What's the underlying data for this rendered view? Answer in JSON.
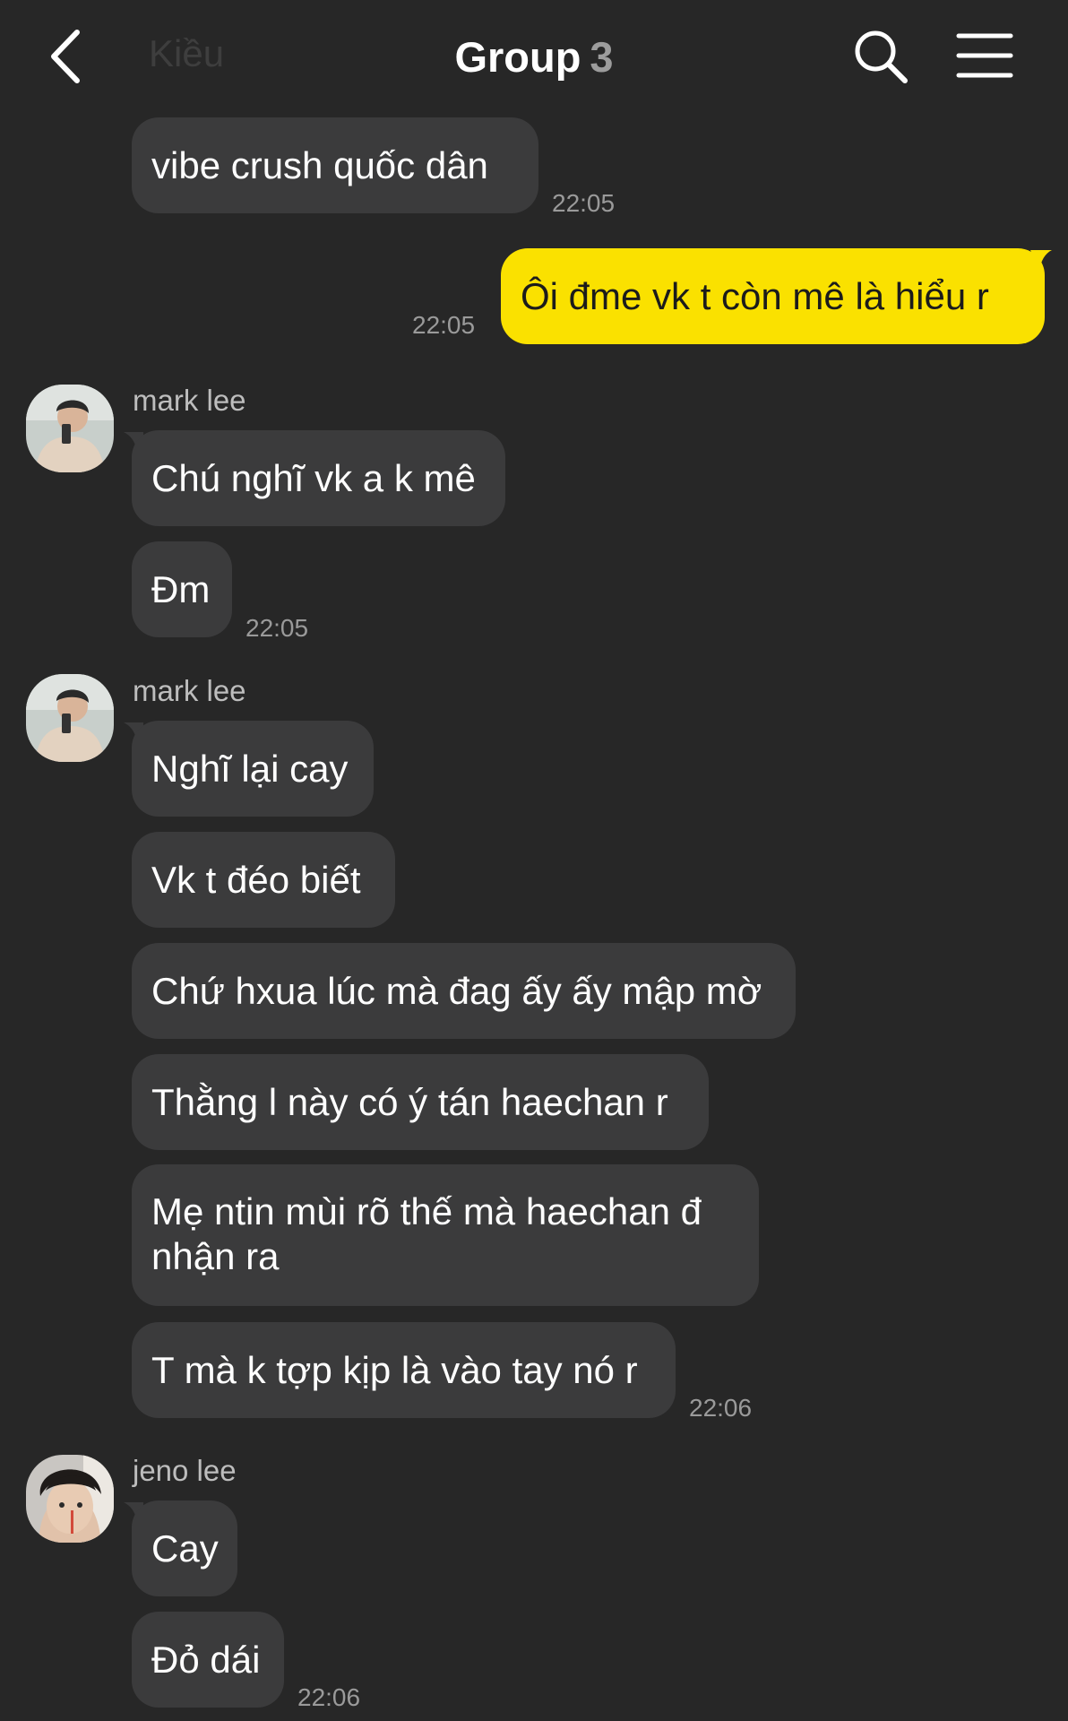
{
  "header": {
    "prev_title": "Kiều",
    "title": "Group",
    "member_count": "3"
  },
  "messages": {
    "m1": {
      "text": "vibe crush quốc dân",
      "time": "22:05"
    },
    "m2": {
      "text": "Ôi đme vk t còn mê là hiểu r",
      "time": "22:05"
    },
    "m3": {
      "sender": "mark lee",
      "text": "Chú nghĩ vk a k mê"
    },
    "m4": {
      "text": "Đm",
      "time": "22:05"
    },
    "m5": {
      "sender": "mark lee",
      "text": "Nghĩ lại cay"
    },
    "m6": {
      "text": "Vk t đéo biết"
    },
    "m7": {
      "text": "Chứ hxua lúc mà đag ấy ấy mập mờ"
    },
    "m8": {
      "text": "Thằng l này có ý tán haechan r"
    },
    "m9": {
      "text": "Mẹ ntin mùi rõ thế mà haechan đ nhận ra"
    },
    "m10": {
      "text": "T mà k tợp kịp là vào tay nó r",
      "time": "22:06"
    },
    "m11": {
      "sender": "jeno lee",
      "text": "Cay"
    },
    "m12": {
      "text": "Đỏ dái",
      "time": "22:06"
    }
  },
  "colors": {
    "background": "#272727",
    "bubble_other": "#3b3b3c",
    "bubble_mine": "#fae100",
    "timestamp": "#9a9a9a"
  },
  "icons": [
    "back-arrow-icon",
    "search-icon",
    "hamburger-menu-icon"
  ]
}
